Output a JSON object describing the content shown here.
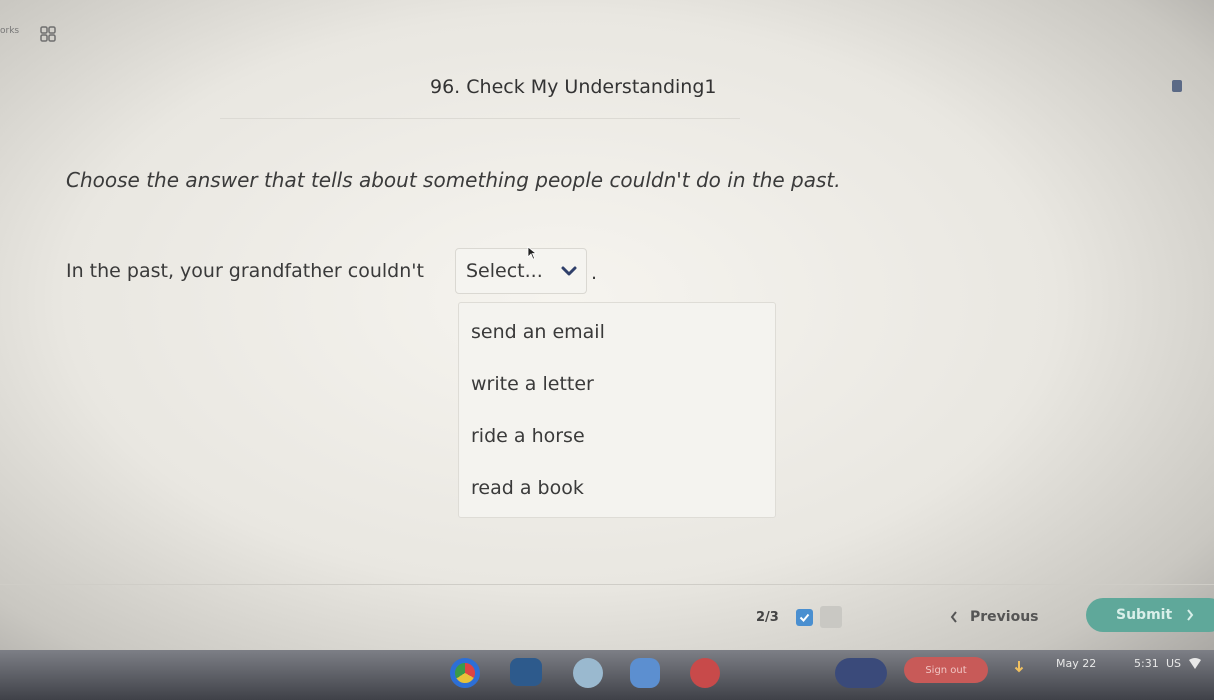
{
  "header": {
    "top_label": "orks",
    "title": "96. Check My Understanding1"
  },
  "question": {
    "prompt": "Choose the answer that tells about something people couldn't do in the past.",
    "sentence": "In the past, your grandfather couldn't",
    "select_label": "Select...",
    "period": ".",
    "options": [
      "send an email",
      "write a letter",
      "ride a horse",
      "read a book"
    ]
  },
  "footer": {
    "progress": "2/3",
    "previous_label": "Previous",
    "submit_label": "Submit"
  },
  "shelf": {
    "signout_label": "Sign out",
    "date": "May 22",
    "time": "5:31",
    "locale": "US"
  },
  "colors": {
    "accent": "#4a8fd0",
    "submit": "#5fa89a",
    "signout": "#c85a58"
  }
}
